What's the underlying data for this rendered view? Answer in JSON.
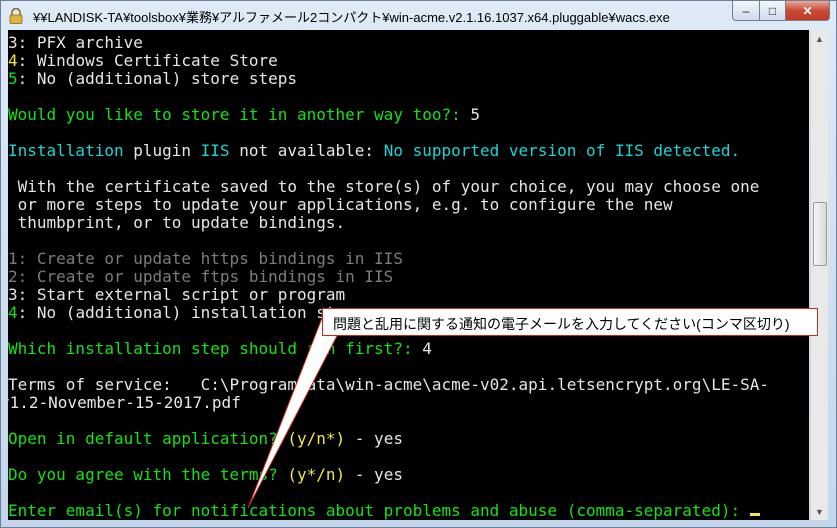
{
  "window": {
    "title": "¥¥LANDISK-TA¥toolsbox¥業務¥アルファメール2コンパクト¥win-acme.v2.1.16.1037.x64.pluggable¥wacs.exe",
    "controls": {
      "minimize": "‒",
      "maximize": "□",
      "close": "✕"
    }
  },
  "console": {
    "l1": {
      "num": "3",
      "text": ": PFX archive"
    },
    "l2": {
      "num": "4",
      "text": ": Windows Certificate Store"
    },
    "l3": {
      "num": "5",
      "text": ": No (additional) store steps"
    },
    "q_store": {
      "text": "Would you like to store it in another way too?:",
      "answer": " 5"
    },
    "inst": {
      "a": "Installation",
      "b": " plugin ",
      "c": "IIS",
      "d": " not available: ",
      "e": "No supported version of IIS detected."
    },
    "p1": " With the certificate saved to the store(s) of your choice, you may choose one",
    "p2": " or more steps to update your applications, e.g. to configure the new",
    "p3": " thumbprint, or to update bindings.",
    "o1": "1: Create or update https bindings in IIS",
    "o2": "2: Create or update ftps bindings in IIS",
    "o3": {
      "num": "3",
      "text": ": Start external script or program"
    },
    "o4": {
      "num": "4",
      "text": ": No (additional) installation steps"
    },
    "q_inst": {
      "text": "Which installation step should run first?:",
      "answer": " 4"
    },
    "terms1": "Terms of service:   C:\\ProgramData\\win-acme\\acme-v02.api.letsencrypt.org\\LE-SA-",
    "terms2": "v1.2-November-15-2017.pdf",
    "q_open": {
      "text": "Open in default application?",
      "opt": " (y/n*)",
      "answer": " - yes"
    },
    "q_agree": {
      "text": "Do you agree with the terms?",
      "opt": " (y*/n)",
      "answer": " - yes"
    },
    "q_email": {
      "text": "Enter email(s) for notifications about problems and abuse (comma-separated):"
    }
  },
  "callout": {
    "text": "問題と乱用に関する通知の電子メールを入力してください(コンマ区切り)"
  },
  "colors": {
    "accent": "#c62b19",
    "console_bg": "#000000",
    "prompt_green": "#13e313",
    "info_cyan": "#18d6d6",
    "option_yellow": "#f2e64b"
  }
}
